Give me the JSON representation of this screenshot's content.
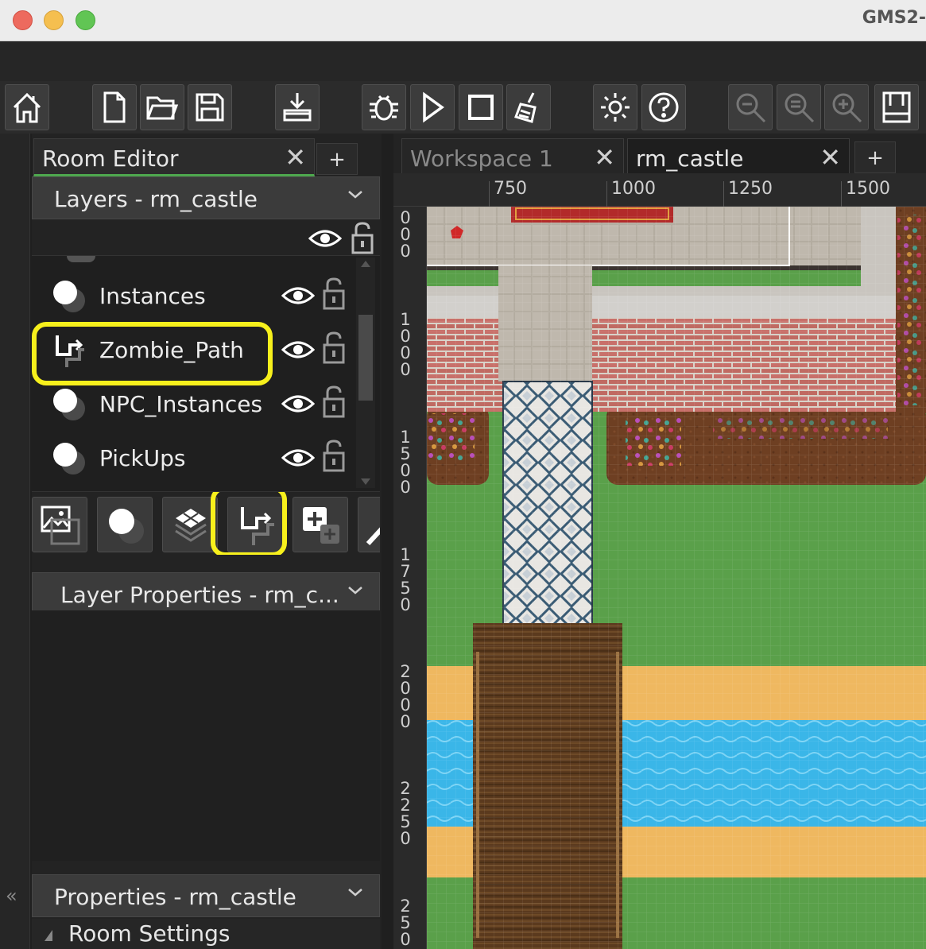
{
  "window": {
    "title": "GMS2-"
  },
  "toolbar": {
    "buttons": [
      {
        "name": "home-icon"
      },
      {
        "name": "new-file-icon"
      },
      {
        "name": "open-folder-icon"
      },
      {
        "name": "save-icon"
      },
      {
        "name": "create-executable-icon"
      },
      {
        "name": "debug-icon"
      },
      {
        "name": "run-icon"
      },
      {
        "name": "stop-icon"
      },
      {
        "name": "clean-icon"
      },
      {
        "name": "settings-icon"
      },
      {
        "name": "help-icon"
      },
      {
        "name": "zoom-out-icon"
      },
      {
        "name": "zoom-reset-icon"
      },
      {
        "name": "zoom-in-icon"
      },
      {
        "name": "layout-icon"
      }
    ]
  },
  "left_panel": {
    "tab": {
      "label": "Room Editor",
      "close": "✕"
    },
    "tab_add": "+",
    "layers_header": "Layers - rm_castle",
    "layers": [
      {
        "name": "Instances",
        "type": "instance"
      },
      {
        "name": "Zombie_Path",
        "type": "path",
        "highlighted": true
      },
      {
        "name": "NPC_Instances",
        "type": "instance"
      },
      {
        "name": "PickUps",
        "type": "instance"
      }
    ],
    "add_layer_buttons": [
      {
        "name": "background-layer-icon"
      },
      {
        "name": "instance-layer-icon"
      },
      {
        "name": "tile-layer-icon"
      },
      {
        "name": "path-layer-icon",
        "highlighted": true
      },
      {
        "name": "asset-layer-icon"
      },
      {
        "name": "filter-layer-icon"
      }
    ],
    "layer_properties_header": "Layer Properties - rm_c...",
    "properties_header": "Properties - rm_castle",
    "room_settings": "Room Settings",
    "collapse": "«"
  },
  "editor_tabs": [
    {
      "label": "Workspace 1",
      "close": "✕",
      "active": false
    },
    {
      "label": "rm_castle",
      "close": "✕",
      "active": true
    }
  ],
  "editor_tab_add": "+",
  "ruler": {
    "top": [
      "750",
      "1000",
      "1250",
      "1500"
    ],
    "left": [
      "1000",
      "1250",
      "1500",
      "1750",
      "2000",
      "2250",
      "250"
    ]
  },
  "colors": {
    "highlight": "#f7f01c",
    "accent": "#4ea84e",
    "grass": "#5aa04a",
    "water": "#3ab6e8",
    "sand": "#efb860",
    "brick": "#c8706a"
  }
}
